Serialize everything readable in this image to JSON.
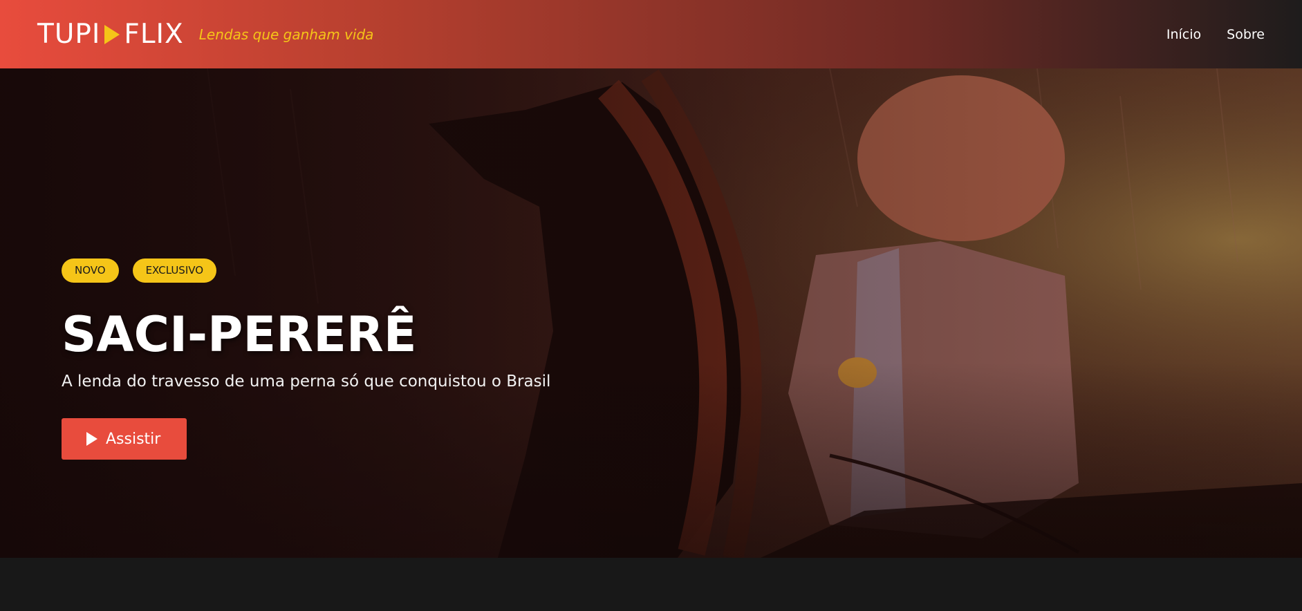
{
  "brand": {
    "logo_left": "TUPI",
    "logo_right": "FLIX",
    "logo_play_icon": "play-triangle-icon",
    "tagline": "Lendas que ganham vida",
    "accent_color": "#f5c518",
    "brand_color": "#e84c3d"
  },
  "nav": {
    "items": [
      {
        "label": "Início"
      },
      {
        "label": "Sobre"
      }
    ]
  },
  "hero": {
    "badges": [
      "NOVO",
      "EXCLUSIVO"
    ],
    "title": "SACI-PERERÊ",
    "subtitle": "A lenda do travesso de uma perna só que conquistou o Brasil",
    "cta": {
      "label": "Assistir",
      "icon": "play-icon"
    }
  }
}
